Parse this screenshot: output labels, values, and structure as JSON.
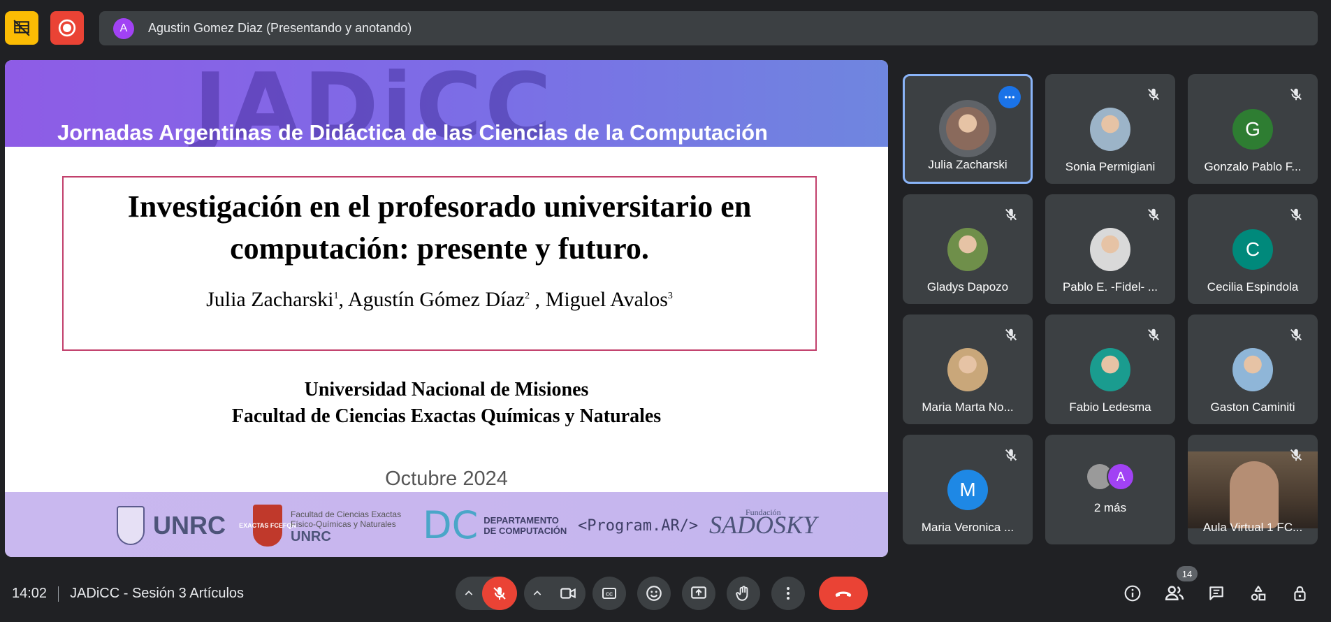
{
  "presenter": {
    "avatar_initial": "A",
    "label": "Agustin Gomez Diaz (Presentando y anotando)"
  },
  "slide": {
    "watermark": "JADiCC",
    "conference": "Jornadas Argentinas de Didáctica de las Ciencias de la Computación",
    "title_line1": "Investigación en el profesorado universitario en",
    "title_line2": "computación: presente y futuro.",
    "authors": [
      {
        "name": "Julia Zacharski",
        "sup": "1"
      },
      {
        "name": "Agustín Gómez Díaz",
        "sup": "2"
      },
      {
        "name": "Miguel Avalos",
        "sup": "3"
      }
    ],
    "author_sep": ", ",
    "author_sep2": " , ",
    "university": "Universidad Nacional de Misiones",
    "faculty": "Facultad de Ciencias Exactas Químicas y Naturales",
    "date": "Octubre 2024",
    "logos": {
      "unrc": "UNRC",
      "fcei_badge": "EXACTAS FCEFQN",
      "fcei_line1": "Facultad de Ciencias Exactas",
      "fcei_line2": "Físico-Químicas y Naturales",
      "fcei_unrc": "UNRC",
      "dpto_line1": "DEPARTAMENTO",
      "dpto_line2": "DE COMPUTACIÓN",
      "program": "<Program.AR/>",
      "sadosky_small": "Fundación",
      "sadosky": "SADOSKY"
    }
  },
  "participants": [
    {
      "name": "Julia Zacharski",
      "type": "photo",
      "muted": false,
      "active": true,
      "color": "#8a6a5c"
    },
    {
      "name": "Sonia Permigiani",
      "type": "photo",
      "muted": true,
      "color": "#9cb4c8"
    },
    {
      "name": "Gonzalo Pablo F...",
      "type": "initial",
      "initial": "G",
      "muted": true,
      "color": "#2e7d32"
    },
    {
      "name": "Gladys Dapozo",
      "type": "photo",
      "muted": true,
      "color": "#6f8f4a"
    },
    {
      "name": "Pablo E. -Fidel- ...",
      "type": "photo",
      "muted": true,
      "color": "#d9d9d9"
    },
    {
      "name": "Cecilia Espindola",
      "type": "initial",
      "initial": "C",
      "muted": true,
      "color": "#00897b"
    },
    {
      "name": "Maria Marta No...",
      "type": "photo",
      "muted": true,
      "color": "#c9a77a"
    },
    {
      "name": "Fabio Ledesma",
      "type": "photo",
      "muted": true,
      "color": "#1a9c8f"
    },
    {
      "name": "Gaston Caminiti",
      "type": "photo",
      "muted": true,
      "color": "#8fb6d8"
    },
    {
      "name": "Maria Veronica ...",
      "type": "initial",
      "initial": "M",
      "muted": true,
      "color": "#1e88e5"
    },
    {
      "name": "2 más",
      "type": "more",
      "initial": "A"
    },
    {
      "name": "Aula Virtual 1 FC...",
      "type": "video",
      "muted": true
    }
  ],
  "bottom": {
    "time": "14:02",
    "meeting": "JADiCC - Sesión 3 Artículos",
    "participant_count": "14"
  }
}
